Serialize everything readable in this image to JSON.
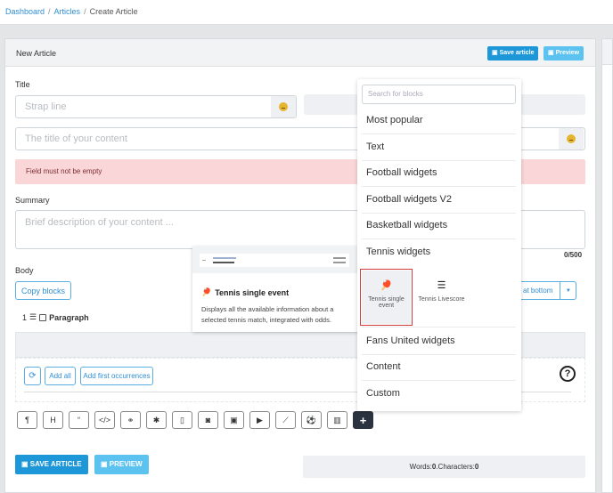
{
  "breadcrumb": [
    {
      "label": "Dashboard",
      "link": true
    },
    {
      "label": "Articles",
      "link": true
    },
    {
      "label": "Create Article",
      "link": false
    }
  ],
  "card": {
    "title": "New Article",
    "save_label": "Save article",
    "preview_label": "Preview"
  },
  "form": {
    "title_label": "Title",
    "strap_placeholder": "Strap line",
    "title_placeholder": "The title of your content",
    "error_text": "Field must not be empty",
    "summary_label": "Summary",
    "summary_placeholder": "Brief description of your content ...",
    "summary_counter": "0/500",
    "body_label": "Body",
    "copy_blocks_label": "Copy blocks",
    "insert_label": "at bottom",
    "paragraph_index": "1",
    "paragraph_label": "Paragraph",
    "add_all_label": "Add all",
    "add_first_label": "Add first occurrences"
  },
  "toolbar": [
    {
      "icon": "paragraph-icon",
      "glyph": "¶"
    },
    {
      "icon": "heading-icon",
      "glyph": "H"
    },
    {
      "icon": "quote-icon",
      "glyph": "“"
    },
    {
      "icon": "code-icon",
      "glyph": "</>"
    },
    {
      "icon": "link-icon",
      "glyph": "⚭"
    },
    {
      "icon": "asterisk-icon",
      "glyph": "✱"
    },
    {
      "icon": "document-icon",
      "glyph": "▯"
    },
    {
      "icon": "camera-icon",
      "glyph": "◙"
    },
    {
      "icon": "image-icon",
      "glyph": "▣"
    },
    {
      "icon": "play-icon",
      "glyph": "▶"
    },
    {
      "icon": "line-chart-icon",
      "glyph": "⟋"
    },
    {
      "icon": "football-icon",
      "glyph": "⚽"
    },
    {
      "icon": "bar-chart-icon",
      "glyph": "▥"
    },
    {
      "icon": "plus-icon",
      "glyph": "+"
    }
  ],
  "footer": {
    "save_label": "SAVE ARTICLE",
    "preview_label": "PREVIEW",
    "words_label": "Words: ",
    "words_value": "0",
    "chars_label": ".Characters: ",
    "chars_value": "0"
  },
  "preview": {
    "title": "Tennis single event",
    "description": "Displays all the available information about a selected tennis match, integrated with odds."
  },
  "dropdown": {
    "search_placeholder": "Search for blocks",
    "categories": [
      "Most popular",
      "Text",
      "Football widgets",
      "Football widgets V2",
      "Basketball widgets",
      "Tennis widgets",
      "Fans United widgets",
      "Content",
      "Custom"
    ],
    "tennis_items": [
      {
        "label": "Tennis single event",
        "icon": "tennis-racket-icon",
        "selected": true
      },
      {
        "label": "Tennis Livescore",
        "icon": "livescore-list-icon",
        "selected": false
      }
    ]
  }
}
